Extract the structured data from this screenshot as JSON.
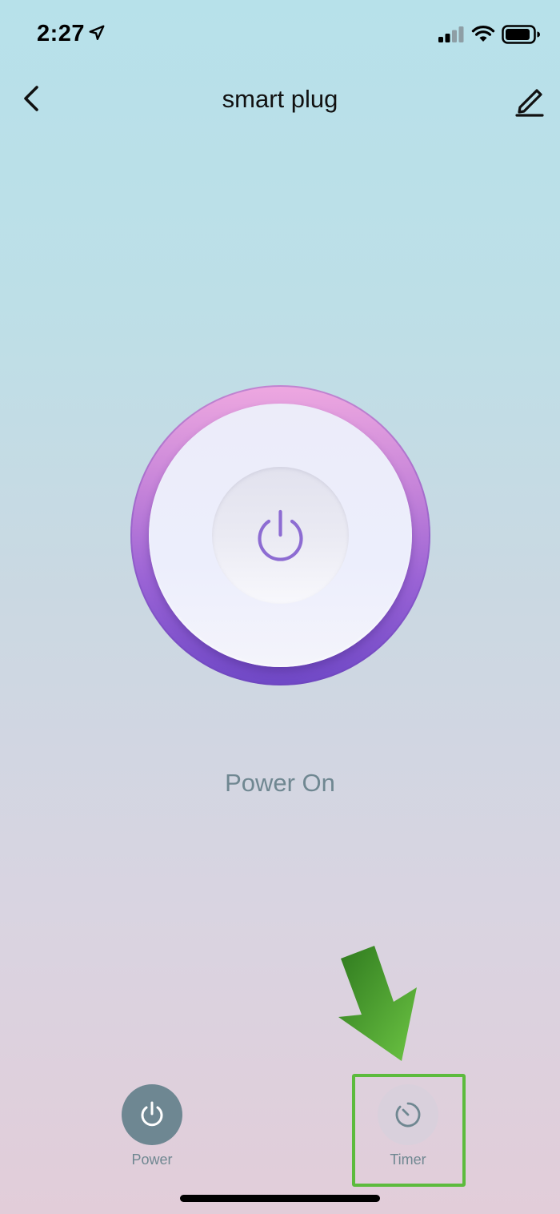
{
  "status_bar": {
    "time": "2:27",
    "location_icon": "location-arrow-icon",
    "signal_icon": "cellular-signal-icon",
    "wifi_icon": "wifi-icon",
    "battery_icon": "battery-icon"
  },
  "nav": {
    "title": "smart plug",
    "back_icon": "chevron-left-icon",
    "edit_icon": "pencil-icon"
  },
  "device": {
    "power_icon": "power-icon",
    "status_text": "Power On",
    "dial_colors": {
      "ring_top": "#eea8e0",
      "ring_bottom": "#6f48c6",
      "icon": "#8d6cd2"
    }
  },
  "annotation": {
    "arrow_icon": "arrow-down-icon",
    "highlight_color": "#5cbb3d"
  },
  "tabs": [
    {
      "label": "Power",
      "icon": "power-icon",
      "active": true
    },
    {
      "label": "Timer",
      "icon": "timer-icon",
      "active": false
    }
  ]
}
